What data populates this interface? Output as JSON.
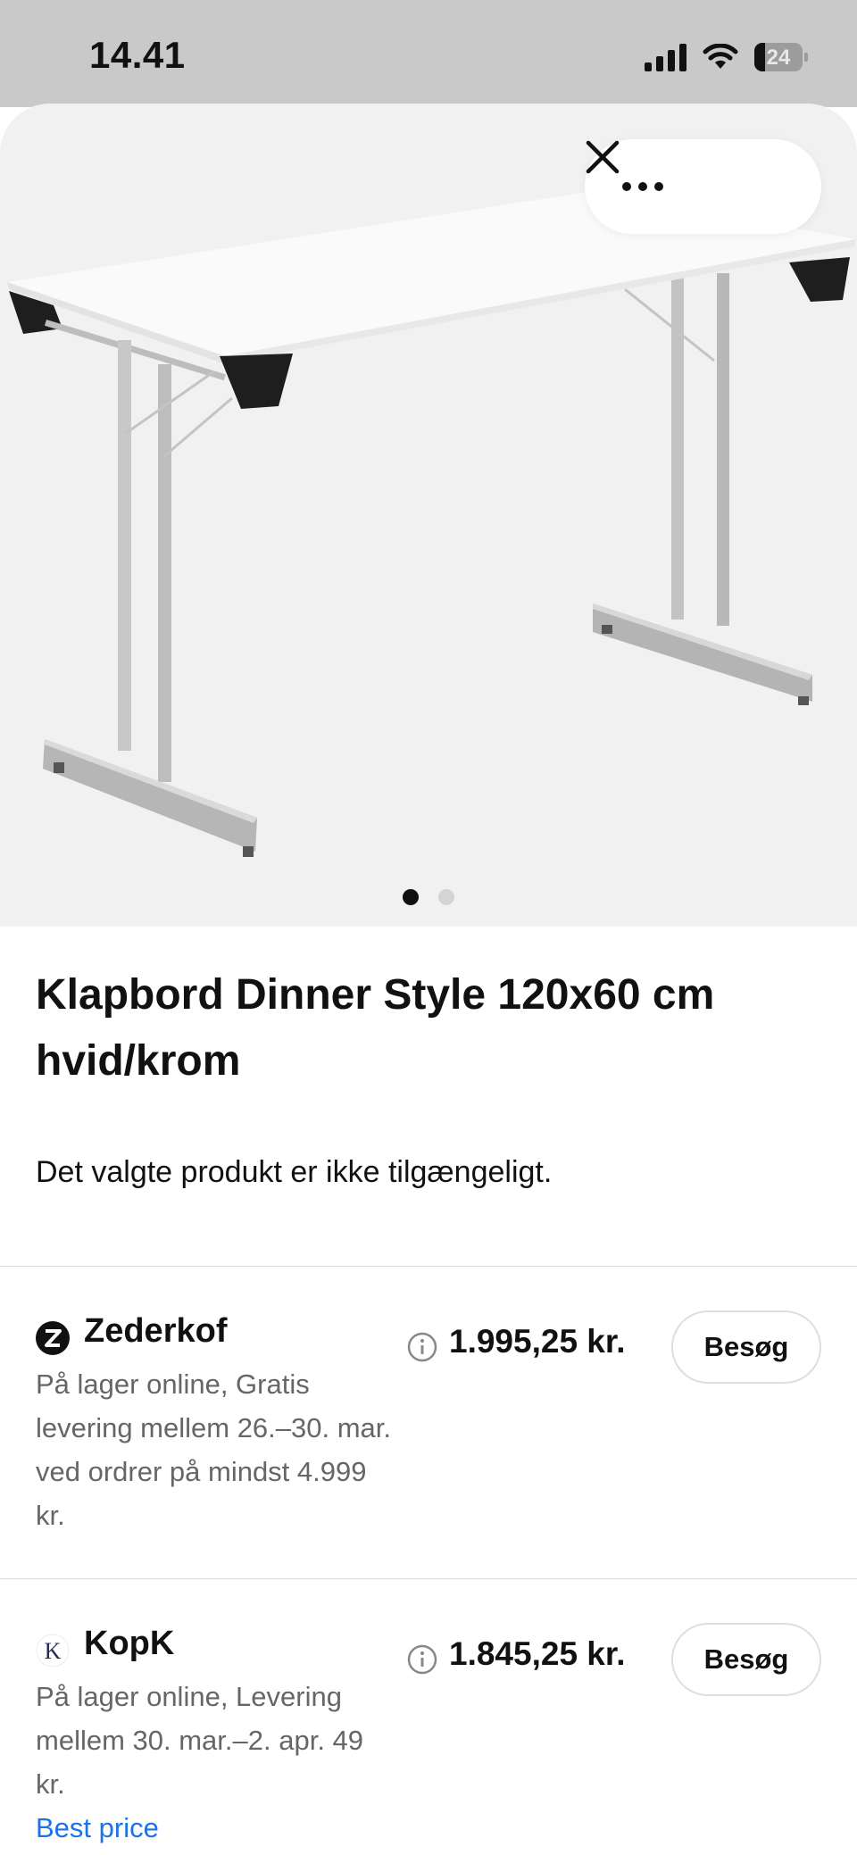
{
  "status_bar": {
    "time": "14.41",
    "battery": "24"
  },
  "gallery": {
    "image_count": 2,
    "active_index": 0
  },
  "product": {
    "title": "Klapbord Dinner Style 120x60 cm hvid/krom",
    "availability_notice": "Det valgte produkt er ikke tilgængeligt."
  },
  "offers": [
    {
      "store": "Zederkof",
      "logo_letter": "Z",
      "description": "På lager online, Gratis levering mellem 26.–30. mar. ved ordrer på mindst 4.999 kr.",
      "price": "1.995,25 kr.",
      "visit_label": "Besøg"
    },
    {
      "store": "KopK",
      "logo_letter": "K",
      "description": "På lager online, Levering mellem 30. mar.–2. apr. 49 kr.",
      "price": "1.845,25 kr.",
      "visit_label": "Besøg",
      "badge": "Best price"
    }
  ],
  "colors": {
    "link": "#1a73e8",
    "muted_text": "#666666",
    "status_bar_bg": "#c9c9c9"
  }
}
